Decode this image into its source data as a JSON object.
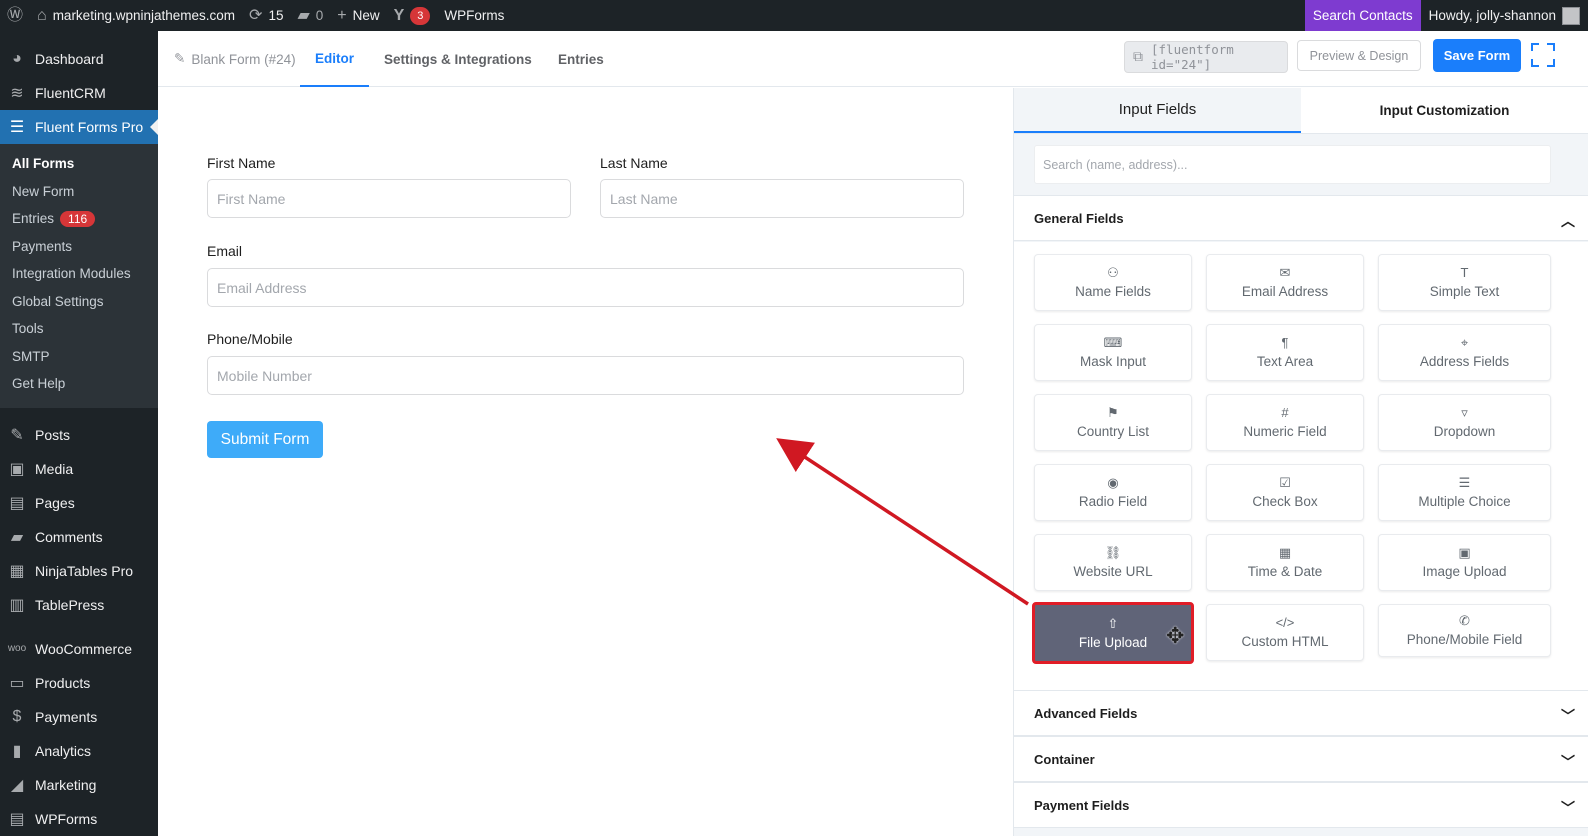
{
  "adminbar": {
    "site_name": "marketing.wpninjathemes.com",
    "updates_count": "15",
    "comments_count": "0",
    "new_label": "New",
    "yoast_count": "3",
    "wpforms_label": "WPForms",
    "search_contacts": "Search Contacts",
    "howdy": "Howdy, jolly-shannon"
  },
  "sidebar": {
    "top_items": [
      {
        "label": "Dashboard",
        "icon": "dashboard-icon"
      },
      {
        "label": "FluentCRM",
        "icon": "fluentcrm-icon"
      },
      {
        "label": "Fluent Forms Pro",
        "icon": "fluentforms-icon"
      }
    ],
    "submenu": [
      "All Forms",
      "New Form",
      "Entries",
      "Payments",
      "Integration Modules",
      "Global Settings",
      "Tools",
      "SMTP",
      "Get Help"
    ],
    "entries_badge": "116",
    "items_2": [
      "Posts",
      "Media",
      "Pages",
      "Comments",
      "NinjaTables Pro",
      "TablePress"
    ],
    "items_3": [
      "WooCommerce",
      "Products",
      "Payments",
      "Analytics",
      "Marketing",
      "WPForms"
    ]
  },
  "topnav": {
    "form_name": "Blank Form (#24)",
    "editor": "Editor",
    "settings": "Settings & Integrations",
    "entries": "Entries",
    "shortcode": "[fluentform id=\"24\"]",
    "preview": "Preview & Design",
    "save": "Save Form"
  },
  "form": {
    "first_name_label": "First Name",
    "first_name_placeholder": "First Name",
    "last_name_label": "Last Name",
    "last_name_placeholder": "Last Name",
    "email_label": "Email",
    "email_placeholder": "Email Address",
    "phone_label": "Phone/Mobile",
    "phone_placeholder": "Mobile Number",
    "submit": "Submit Form"
  },
  "panel": {
    "tab_fields": "Input Fields",
    "tab_custom": "Input Customization",
    "search_placeholder": "Search (name, address)...",
    "general_fields": "General Fields",
    "fields": [
      {
        "label": "Name Fields",
        "icon": "user-icon"
      },
      {
        "label": "Email Address",
        "icon": "envelope-icon"
      },
      {
        "label": "Simple Text",
        "icon": "text-icon"
      },
      {
        "label": "Mask Input",
        "icon": "keyboard-icon"
      },
      {
        "label": "Text Area",
        "icon": "paragraph-icon"
      },
      {
        "label": "Address Fields",
        "icon": "map-pin-icon"
      },
      {
        "label": "Country List",
        "icon": "flag-icon"
      },
      {
        "label": "Numeric Field",
        "icon": "hash-icon"
      },
      {
        "label": "Dropdown",
        "icon": "dropdown-icon"
      },
      {
        "label": "Radio Field",
        "icon": "radio-icon"
      },
      {
        "label": "Check Box",
        "icon": "checkbox-icon"
      },
      {
        "label": "Multiple Choice",
        "icon": "list-icon"
      },
      {
        "label": "Website URL",
        "icon": "link-icon"
      },
      {
        "label": "Time & Date",
        "icon": "calendar-icon"
      },
      {
        "label": "Image Upload",
        "icon": "image-icon"
      },
      {
        "label": "File Upload",
        "icon": "upload-icon"
      },
      {
        "label": "Custom HTML",
        "icon": "code-icon"
      },
      {
        "label": "Phone/Mobile Field",
        "icon": "phone-icon"
      }
    ],
    "advanced_fields": "Advanced Fields",
    "container": "Container",
    "payment_fields": "Payment Fields"
  },
  "colors": {
    "accent": "#1a7efb",
    "admin_bg": "#1d2327",
    "highlight_red": "#e11d27",
    "dragging_bg": "#606478"
  }
}
